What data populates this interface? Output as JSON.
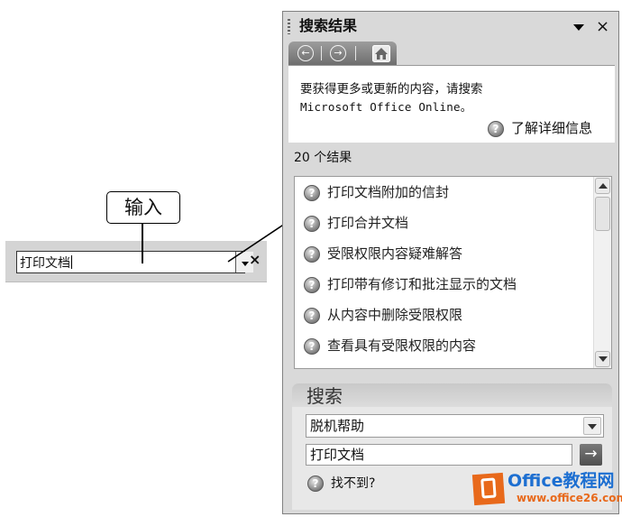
{
  "help_box": {
    "input_value": "打印文档",
    "close_glyph": "×",
    "callout_label": "输入"
  },
  "task_pane": {
    "title": "搜索结果",
    "close_glyph": "×",
    "nav": {
      "back_icon": "back-arrow-icon",
      "forward_icon": "forward-arrow-icon",
      "home_icon": "home-icon"
    },
    "info": {
      "line1": "要获得更多或更新的内容，请搜索",
      "line2": "Microsoft Office Online。",
      "learn_more": "了解详细信息"
    },
    "results_count": "20 个结果",
    "results": [
      "打印文档附加的信封",
      "打印合并文档",
      "受限权限内容疑难解答",
      "打印带有修订和批注显示的文档",
      "从内容中删除受限权限",
      "查看具有受限权限的内容"
    ],
    "search": {
      "title": "搜索",
      "scope_value": "脱机帮助",
      "query_value": "打印文档",
      "go_glyph": "→",
      "not_found": "找不到?"
    }
  },
  "watermark": {
    "title": "Office教程网",
    "url": "www.office26.com"
  },
  "colors": {
    "pane_bg": "#d9d9d9",
    "nav_gray": "#7d7d7d",
    "brand_orange": "#e8691b",
    "brand_blue": "#1d6fd1"
  }
}
